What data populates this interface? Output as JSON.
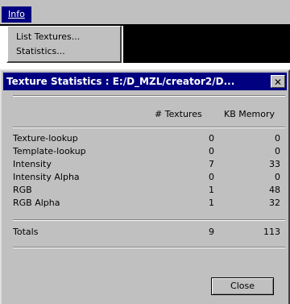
{
  "menubar": {
    "info_label": "Info"
  },
  "dropdown": {
    "items": [
      {
        "label": "List Textures..."
      },
      {
        "label": "Statistics..."
      }
    ]
  },
  "dialog": {
    "title": "Texture Statistics : E:/D_MZL/creator2/D...",
    "close_glyph": "✕",
    "columns": {
      "textures": "# Textures",
      "kb": "KB Memory"
    },
    "rows": [
      {
        "name": "Texture-lookup",
        "textures": "0",
        "kb": "0"
      },
      {
        "name": "Template-lookup",
        "textures": "0",
        "kb": "0"
      },
      {
        "name": "Intensity",
        "textures": "7",
        "kb": "33"
      },
      {
        "name": "Intensity Alpha",
        "textures": "0",
        "kb": "0"
      },
      {
        "name": "RGB",
        "textures": "1",
        "kb": "48"
      },
      {
        "name": "RGB Alpha",
        "textures": "1",
        "kb": "32"
      }
    ],
    "totals": {
      "name": "Totals",
      "textures": "9",
      "kb": "113"
    },
    "close_button_label": "Close"
  }
}
